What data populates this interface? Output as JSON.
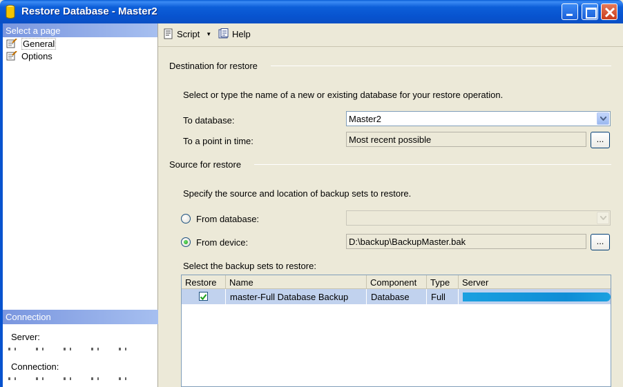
{
  "window": {
    "title": "Restore Database - Master2"
  },
  "left_pane": {
    "select_page_header": "Select a page",
    "pages": [
      {
        "label": "General",
        "icon": "page-icon",
        "selected": true
      },
      {
        "label": "Options",
        "icon": "page-icon",
        "selected": false
      }
    ],
    "connection_header": "Connection",
    "server_label": "Server:",
    "connection_label": "Connection:"
  },
  "toolbar": {
    "script_label": "Script",
    "help_label": "Help"
  },
  "destination": {
    "section_title": "Destination for restore",
    "instructions": "Select or type the name of a new or existing database for your restore operation.",
    "to_database_label": "To database:",
    "to_database_value": "Master2",
    "point_in_time_label": "To a point in time:",
    "point_in_time_value": "Most recent possible",
    "browse_label": "..."
  },
  "source": {
    "section_title": "Source for restore",
    "instructions": "Specify the source and location of backup sets to restore.",
    "from_database_label": "From database:",
    "from_database_value": "",
    "from_device_label": "From device:",
    "from_device_value": "D:\\backup\\BackupMaster.bak",
    "selected_source": "from_device",
    "browse_label": "...",
    "backup_sets_label": "Select the backup sets to restore:"
  },
  "backup_grid": {
    "columns": [
      "Restore",
      "Name",
      "Component",
      "Type",
      "Server"
    ],
    "rows": [
      {
        "restore": true,
        "name": "master-Full Database Backup",
        "component": "Database",
        "type": "Full",
        "server": ""
      }
    ]
  },
  "colors": {
    "titlebar": "#0753cf",
    "pane_header": "#7a96df",
    "selected_row": "#c1d2ee",
    "dialog_bg": "#ece9d8"
  }
}
